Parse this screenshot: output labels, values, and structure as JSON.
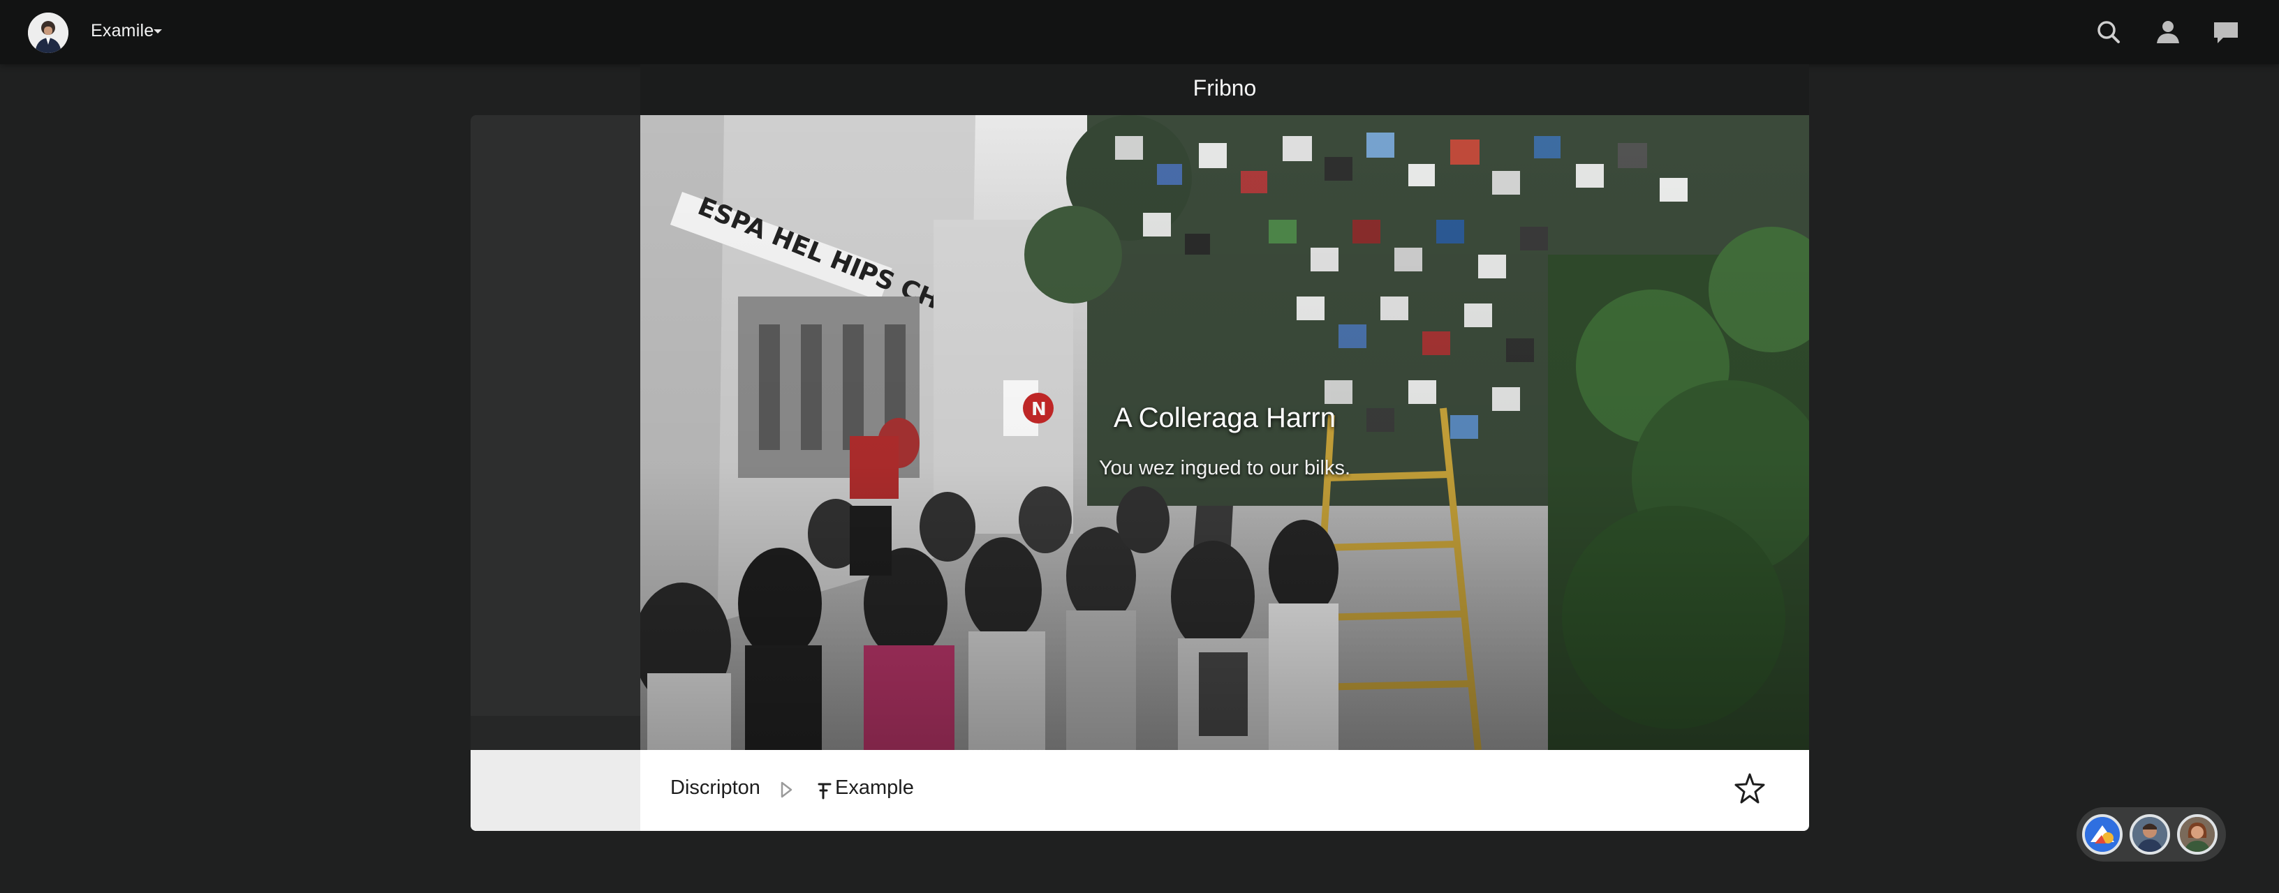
{
  "header": {
    "account_name": "Examile",
    "icons": [
      "search-icon",
      "person-icon",
      "chat-icon"
    ]
  },
  "stage": {
    "title": "Fribno"
  },
  "hero": {
    "title": "A Colleraga Harrn",
    "subtitle": "You wez ingued to our bilks."
  },
  "footer": {
    "crumb_1": "Discripton",
    "crumb_2": "Example",
    "star_icon": "star-icon"
  },
  "participants": {
    "count_visible": 3
  },
  "colors": {
    "page_bg": "#1f2020",
    "topbar_bg": "#121313",
    "footer_bg": "#ffffff",
    "accent_blue": "#2f6fe0"
  }
}
